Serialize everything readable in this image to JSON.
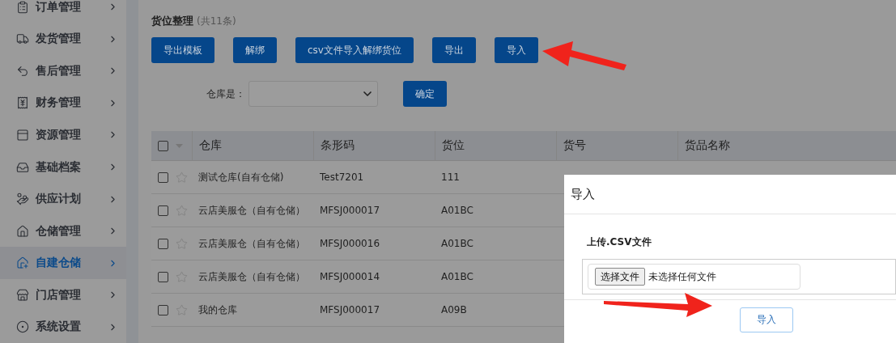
{
  "sidebar": {
    "items": [
      {
        "label": "订单管理",
        "selected": false
      },
      {
        "label": "发货管理",
        "selected": false
      },
      {
        "label": "售后管理",
        "selected": false
      },
      {
        "label": "财务管理",
        "selected": false
      },
      {
        "label": "资源管理",
        "selected": false
      },
      {
        "label": "基础档案",
        "selected": false
      },
      {
        "label": "供应计划",
        "selected": false
      },
      {
        "label": "仓储管理",
        "selected": false
      },
      {
        "label": "自建仓储",
        "selected": true
      },
      {
        "label": "门店管理",
        "selected": false
      },
      {
        "label": "系统设置",
        "selected": false
      }
    ]
  },
  "page": {
    "title": "货位整理",
    "count": "(共11条)"
  },
  "toolbar": [
    "导出模板",
    "解绑",
    "csv文件导入解绑货位",
    "导出",
    "导入"
  ],
  "filter": {
    "label": "仓库是：",
    "button": "确定"
  },
  "table": {
    "header_checked": false,
    "columns": [
      "仓库",
      "条形码",
      "货位",
      "货号",
      "货品名称"
    ],
    "rows": [
      {
        "checked": false,
        "starred": false,
        "cells": [
          "测试仓库(自有仓储)",
          "Test7201",
          "111"
        ]
      },
      {
        "checked": false,
        "starred": false,
        "cells": [
          "云店美服仓（自有仓储）",
          "MFSJ000017",
          "A01BC"
        ]
      },
      {
        "checked": false,
        "starred": false,
        "cells": [
          "云店美服仓（自有仓储）",
          "MFSJ000016",
          "A01BC"
        ]
      },
      {
        "checked": false,
        "starred": false,
        "cells": [
          "云店美服仓（自有仓储）",
          "MFSJ000014",
          "A01BC"
        ]
      },
      {
        "checked": false,
        "starred": false,
        "cells": [
          "我的仓库",
          "MFSJ000017",
          "A09B"
        ]
      }
    ]
  },
  "dialog": {
    "title": "导入",
    "label": "上传.CSV文件",
    "file_button": "选择文件",
    "file_status": "未选择任何文件",
    "submit": "导入"
  }
}
